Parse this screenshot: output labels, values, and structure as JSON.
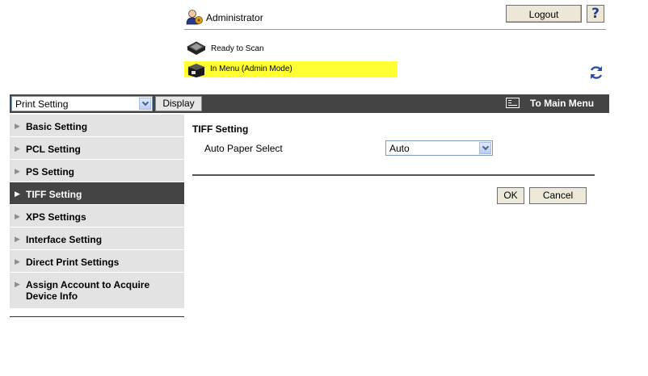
{
  "header": {
    "user_label": "Administrator",
    "logout_label": "Logout",
    "help_label": "?",
    "status_items": [
      {
        "label": "Ready to Scan",
        "icon": "scanner-icon"
      },
      {
        "label": "In Menu (Admin Mode)",
        "icon": "printer-icon",
        "highlight": "#ffff33"
      }
    ]
  },
  "toolbar": {
    "setting_select_value": "Print Setting",
    "display_label": "Display",
    "main_menu_label": "To Main Menu"
  },
  "sidebar": {
    "items": [
      {
        "label": "Basic Setting"
      },
      {
        "label": "PCL Setting"
      },
      {
        "label": "PS Setting"
      },
      {
        "label": "TIFF Setting",
        "active": true
      },
      {
        "label": "XPS Settings"
      },
      {
        "label": "Interface Setting"
      },
      {
        "label": "Direct Print Settings"
      },
      {
        "label": "Assign Account to Acquire Device Info"
      }
    ]
  },
  "main": {
    "section_title": "TIFF Setting",
    "field_label": "Auto Paper Select",
    "field_value": "Auto",
    "ok_label": "OK",
    "cancel_label": "Cancel"
  },
  "colors": {
    "bar": "#444444",
    "sidebar_bg": "#e3e3e3",
    "highlight": "#ffff33"
  }
}
